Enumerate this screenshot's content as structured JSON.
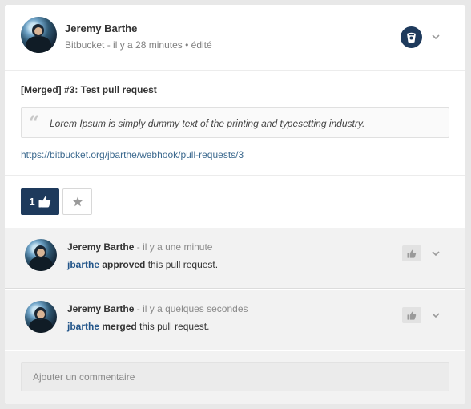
{
  "post": {
    "author": "Jeremy Barthe",
    "source": "Bitbucket",
    "time": "il y a 28 minutes",
    "edited": "édité",
    "title": "[Merged] #3: Test pull request",
    "quote": "Lorem Ipsum is simply dummy text of the printing and typesetting industry.",
    "link": "https://bitbucket.org/jbarthe/webhook/pull-requests/3",
    "like_count": "1"
  },
  "activities": [
    {
      "author": "Jeremy Barthe",
      "time": "il y a une minute",
      "user": "jbarthe",
      "verb": "approved",
      "rest": "this pull request."
    },
    {
      "author": "Jeremy Barthe",
      "time": "il y a quelques secondes",
      "user": "jbarthe",
      "verb": "merged",
      "rest": "this pull request."
    }
  ],
  "comment": {
    "placeholder": "Ajouter un commentaire"
  },
  "colors": {
    "accent": "#1e3a5c",
    "link": "#3d6a8f",
    "user": "#23568a"
  },
  "icons": [
    "bitbucket-icon",
    "chevron-down-icon",
    "thumbs-up-icon",
    "star-icon",
    "quote-icon"
  ]
}
